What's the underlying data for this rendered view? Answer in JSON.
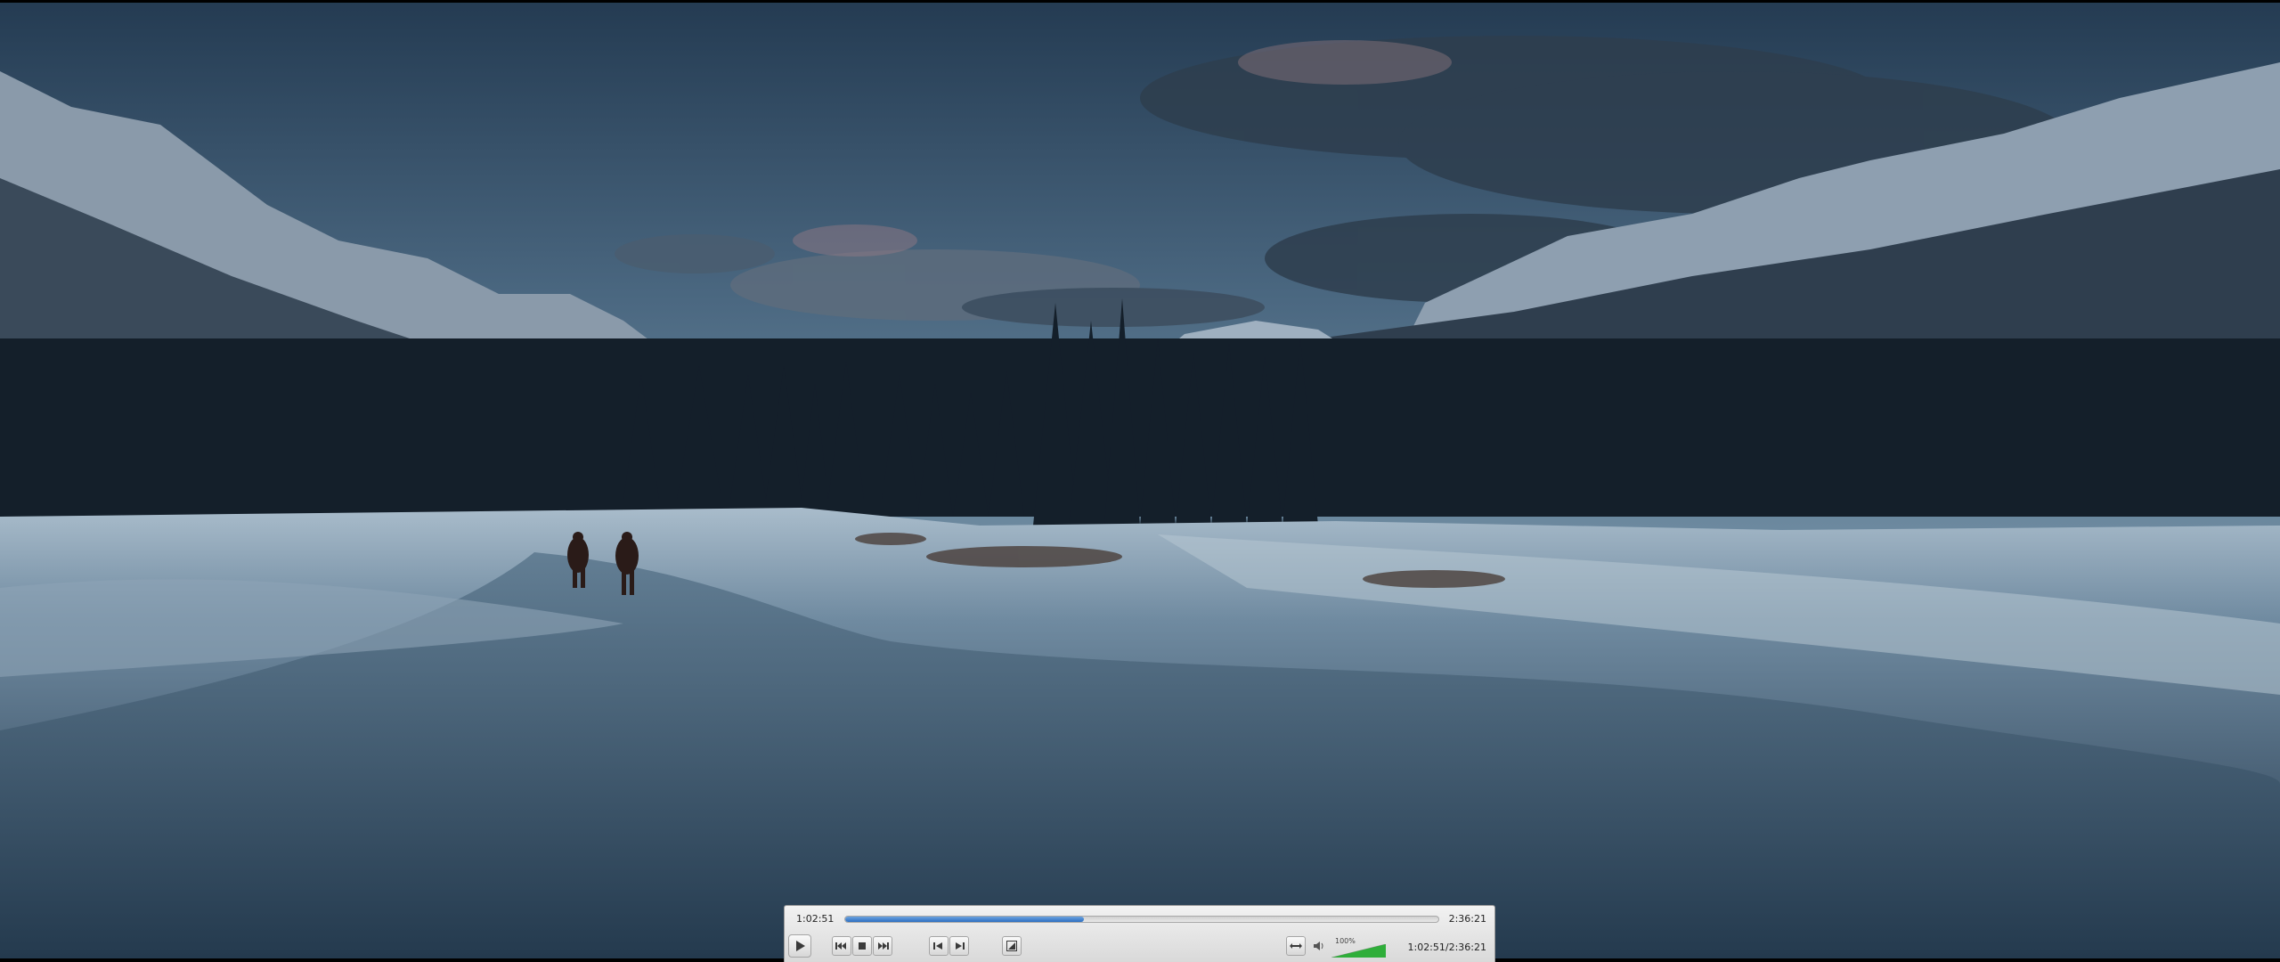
{
  "player": {
    "elapsed": "1:02:51",
    "total": "2:36:21",
    "readout": "1:02:51/2:36:21",
    "progress_fraction": 0.402,
    "volume_label": "100%",
    "volume_fraction": 1.0
  },
  "colors": {
    "accent": "#2d6fc2",
    "volume": "#2fae3a"
  },
  "icons": {
    "play": "play-icon",
    "prev": "skip-back-icon",
    "stop": "stop-icon",
    "next": "skip-forward-icon",
    "frame_back": "frame-back-icon",
    "frame_fwd": "frame-forward-icon",
    "snapshot": "snapshot-icon",
    "aspect": "aspect-ratio-icon",
    "volume": "speaker-icon"
  }
}
